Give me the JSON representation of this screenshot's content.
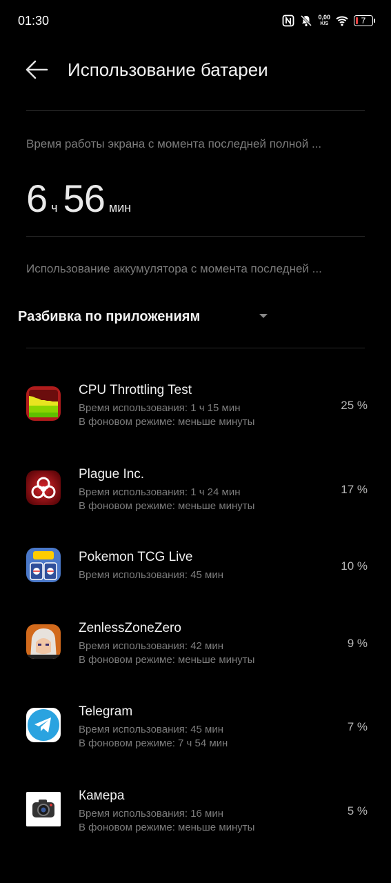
{
  "status": {
    "time": "01:30",
    "net_speed_value": "0,00",
    "net_speed_unit": "K/S",
    "battery_level": "7"
  },
  "header": {
    "title": "Использование батареи"
  },
  "screen_time": {
    "label": "Время работы экрана с момента последней полной ...",
    "hours": "6",
    "hours_unit": "ч",
    "minutes": "56",
    "minutes_unit": "мин"
  },
  "usage": {
    "label": "Использование аккумулятора с момента последней ...",
    "dropdown_label": "Разбивка по приложениям"
  },
  "apps": [
    {
      "name": "CPU Throttling Test",
      "usage": "Время использования: 1 ч 15 мин",
      "background": "В фоновом режиме: меньше минуты",
      "percent": "25 %",
      "icon": "cpu-throttling-test-icon"
    },
    {
      "name": "Plague Inc.",
      "usage": "Время использования: 1 ч 24 мин",
      "background": "В фоновом режиме: меньше минуты",
      "percent": "17 %",
      "icon": "plague-inc-icon"
    },
    {
      "name": "Pokemon TCG Live",
      "usage": "Время использования: 45 мин",
      "background": "",
      "percent": "10 %",
      "icon": "pokemon-tcg-live-icon"
    },
    {
      "name": "ZenlessZoneZero",
      "usage": "Время использования: 42 мин",
      "background": "В фоновом режиме: меньше минуты",
      "percent": "9 %",
      "icon": "zenless-zone-zero-icon"
    },
    {
      "name": "Telegram",
      "usage": "Время использования: 45 мин",
      "background": "В фоновом режиме: 7 ч 54 мин",
      "percent": "7 %",
      "icon": "telegram-icon"
    },
    {
      "name": "Камера",
      "usage": "Время использования: 16 мин",
      "background": "В фоновом режиме: меньше минуты",
      "percent": "5 %",
      "icon": "camera-icon"
    }
  ]
}
